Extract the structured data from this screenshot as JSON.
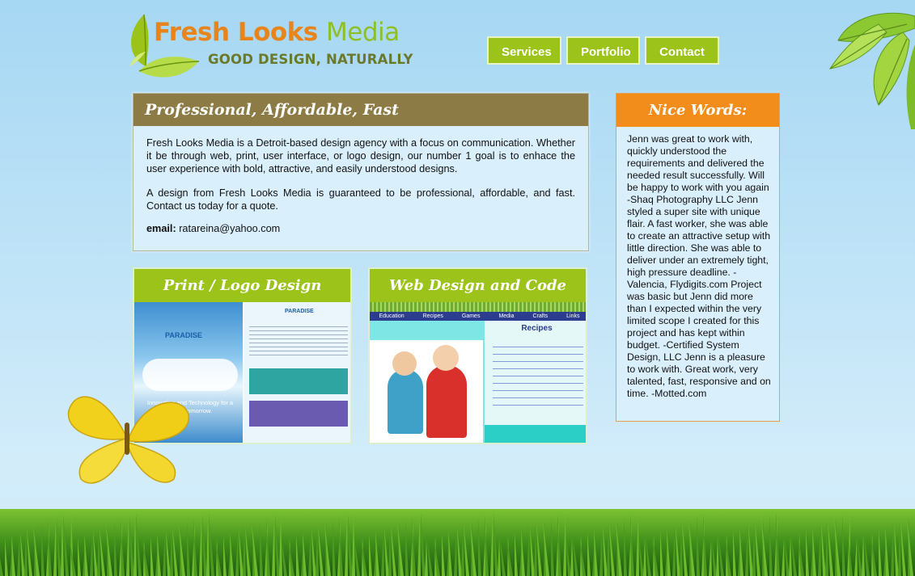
{
  "logo": {
    "name_part1": "Fresh Looks",
    "name_part2": "Media",
    "tagline": "GOOD DESIGN, NATURALLY"
  },
  "nav": {
    "items": [
      "Services",
      "Portfolio",
      "Contact"
    ]
  },
  "main": {
    "heading": "Professional, Affordable, Fast",
    "paragraph1": "Fresh Looks Media is a Detroit-based design agency with a focus on communication. Whether it be through web, print, user interface, or logo design, our number 1 goal is to enhace the user experience with bold, attractive, and easily understood designs.",
    "paragraph2": "A design from Fresh Looks Media is guaranteed to be professional, affordable, and fast. Contact us today for a quote.",
    "email_label": "email:",
    "email_value": "ratareina@yahoo.com"
  },
  "portfolio": {
    "print_title": "Print / Logo Design",
    "web_title": "Web Design and Code"
  },
  "thumbnails": {
    "print_brand": "PARADISE",
    "print_slogan": "Innovation and Technology for a better tomorrow.",
    "web_nav": [
      "Education",
      "Recipes",
      "Games",
      "Media",
      "Crafts",
      "Links"
    ],
    "web_section": "Recipes"
  },
  "testimonials": {
    "heading": "Nice Words:",
    "text": "Jenn was great to work with, quickly understood the requirements and delivered the needed result successfully. Will be happy to work with you again -Shaq Photography LLC Jenn styled a super site with unique flair. A fast worker, she was able to create an attractive setup with little direction. She was able to deliver under an extremely tight, high pressure deadline. -Valencia, Flydigits.com Project was basic but Jenn did more than I expected within the very limited scope I created for this project and has kept within budget. -Certified System Design, LLC Jenn is a pleasure to work with. Great work, very talented, fast, responsive and on time. -Motted.com"
  },
  "colors": {
    "sky": "#a6d7f3",
    "nav_green": "#9cc319",
    "header_brown": "#8c7b44",
    "header_orange": "#f28c1a",
    "panel_bg": "#d9effb"
  }
}
